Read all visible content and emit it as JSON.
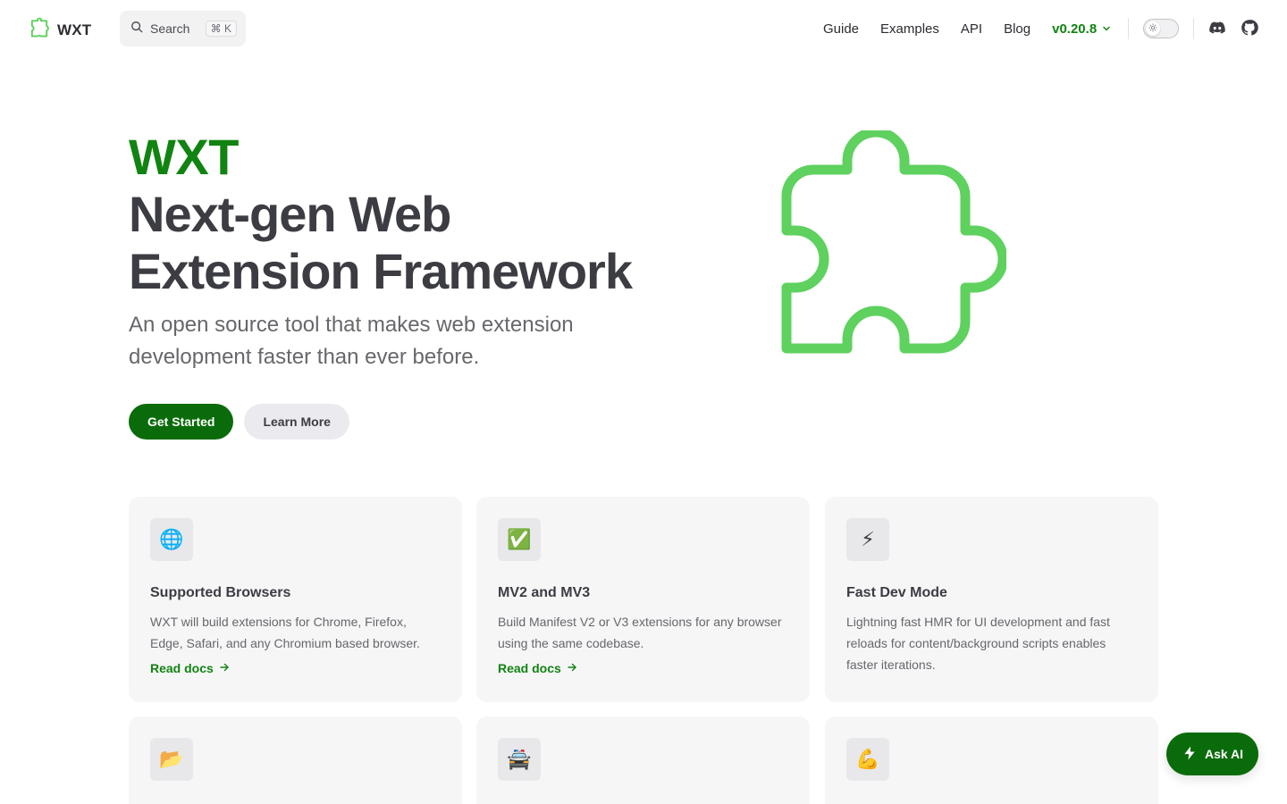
{
  "nav": {
    "title": "WXT",
    "search": {
      "label": "Search",
      "shortcut": "⌘ K"
    },
    "links": [
      {
        "label": "Guide"
      },
      {
        "label": "Examples"
      },
      {
        "label": "API"
      },
      {
        "label": "Blog"
      }
    ],
    "version": "v0.20.8",
    "icons": {
      "logo": "puzzle-piece-icon",
      "search": "search-icon",
      "theme": "sun-icon",
      "discord": "discord-icon",
      "github": "github-icon"
    }
  },
  "hero": {
    "name": "WXT",
    "text": "Next-gen Web Extension Framework",
    "tagline": "An open source tool that makes web extension development faster than ever before.",
    "actions": [
      {
        "label": "Get Started",
        "theme": "brand"
      },
      {
        "label": "Learn More",
        "theme": "alt"
      }
    ],
    "image": "puzzle-piece-icon"
  },
  "features": [
    {
      "icon": "🌐",
      "title": "Supported Browsers",
      "details": "WXT will build extensions for Chrome, Firefox, Edge, Safari, and any Chromium based browser.",
      "link": "Read docs"
    },
    {
      "icon": "✅",
      "title": "MV2 and MV3",
      "details": "Build Manifest V2 or V3 extensions for any browser using the same codebase.",
      "link": "Read docs"
    },
    {
      "icon": "⚡",
      "title": "Fast Dev Mode",
      "details": "Lightning fast HMR for UI development and fast reloads for content/background scripts enables faster iterations.",
      "link": ""
    },
    {
      "icon": "📂",
      "title": "",
      "details": "",
      "link": ""
    },
    {
      "icon": "🚔",
      "title": "",
      "details": "",
      "link": ""
    },
    {
      "icon": "💪",
      "title": "",
      "details": "",
      "link": ""
    }
  ],
  "ask_ai": {
    "label": "Ask AI"
  },
  "colors": {
    "brand": "#118311",
    "brand_dark": "#0a6b0a",
    "logo_green": "#5ed15e",
    "text": "#3c3c43",
    "muted": "#67676c",
    "card": "#f6f6f7"
  }
}
